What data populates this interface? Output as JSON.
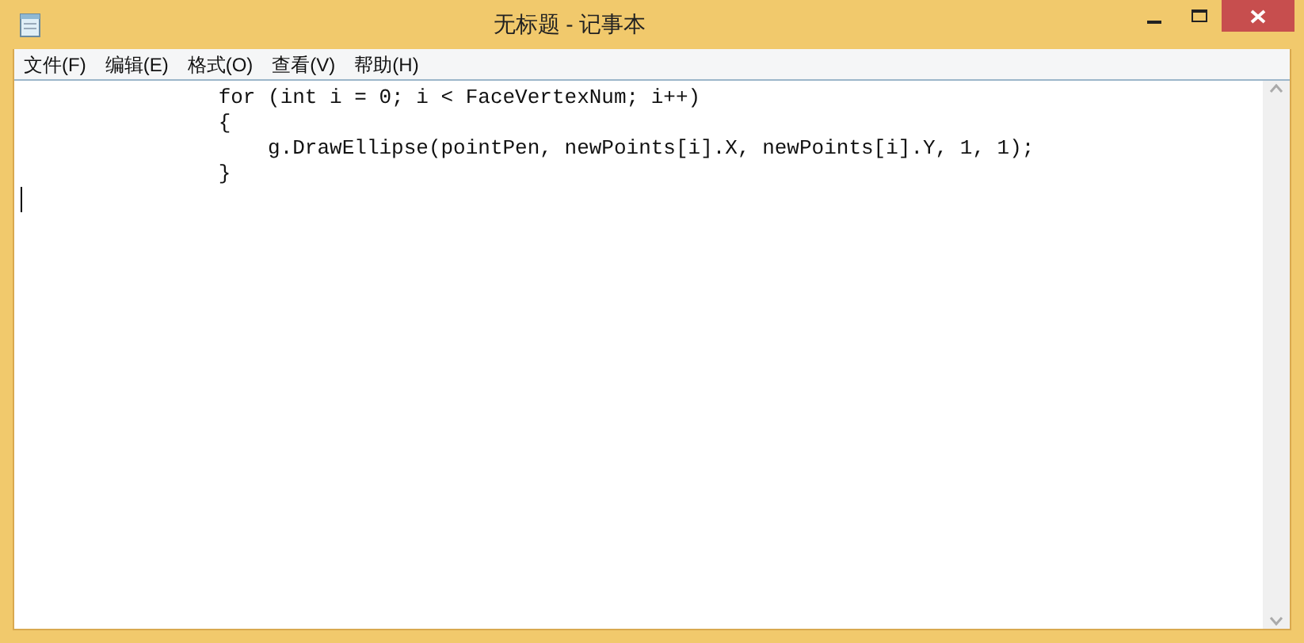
{
  "window": {
    "title": "无标题 - 记事本"
  },
  "menu": [
    {
      "label": "文件(F)"
    },
    {
      "label": "编辑(E)"
    },
    {
      "label": "格式(O)"
    },
    {
      "label": "查看(V)"
    },
    {
      "label": "帮助(H)"
    }
  ],
  "editor": {
    "lines": [
      "\t\tfor (int i = 0; i < FaceVertexNum; i++)",
      "\t\t{",
      "\t\t    g.DrawEllipse(pointPen, newPoints[i].X, newPoints[i].Y, 1, 1);",
      "\t\t}"
    ]
  }
}
